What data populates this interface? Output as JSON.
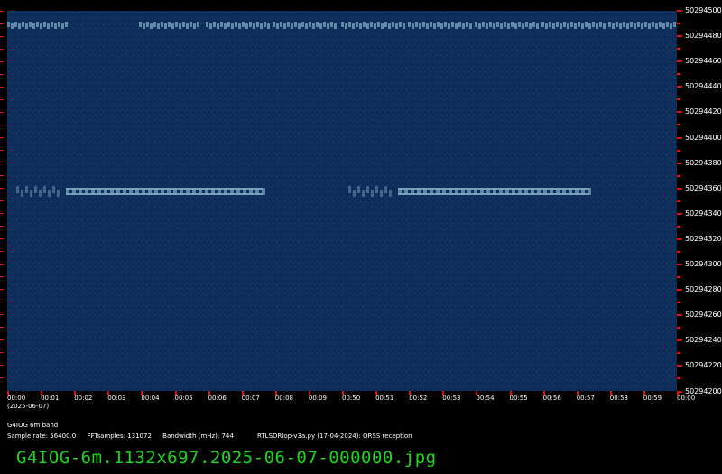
{
  "window_title": "G4IOG-6m.1132x697.2025-06-07-000000.jpg",
  "station": "G4IOG 6m band",
  "date": "(2025-06-07)",
  "params": {
    "sample_rate": "Sample rate: 56400.0",
    "fft_samples": "FFTsamples: 131072",
    "bandwidth": "Bandwidth (mHz): 744",
    "software": "RTLSDRIop-v3a.py (17-04-2024): QRSS reception"
  },
  "filename": "G4IOG-6m.1132x697.2025-06-07-000000.jpg",
  "x_labels": [
    "00:00",
    "00:01",
    "00:02",
    "00:03",
    "00:04",
    "00:05",
    "00:06",
    "00:07",
    "00:08",
    "00:09",
    "00:50",
    "00:51",
    "00:52",
    "00:53",
    "00:54",
    "00:55",
    "00:56",
    "00:57",
    "00:58",
    "00:59",
    "00:00"
  ],
  "y_labels": [
    "50294500",
    "50294480",
    "50294460",
    "50294440",
    "50294420",
    "50294400",
    "50294380",
    "50294360",
    "50294340",
    "50294320",
    "50294300",
    "50294280",
    "50294260",
    "50294240",
    "50294220",
    "50294200"
  ],
  "colors": {
    "background": "#0f2d5a",
    "tick": "#e01010",
    "label": "#ffffff",
    "filename": "#1ed81e",
    "signal": "#7fa9c2"
  }
}
